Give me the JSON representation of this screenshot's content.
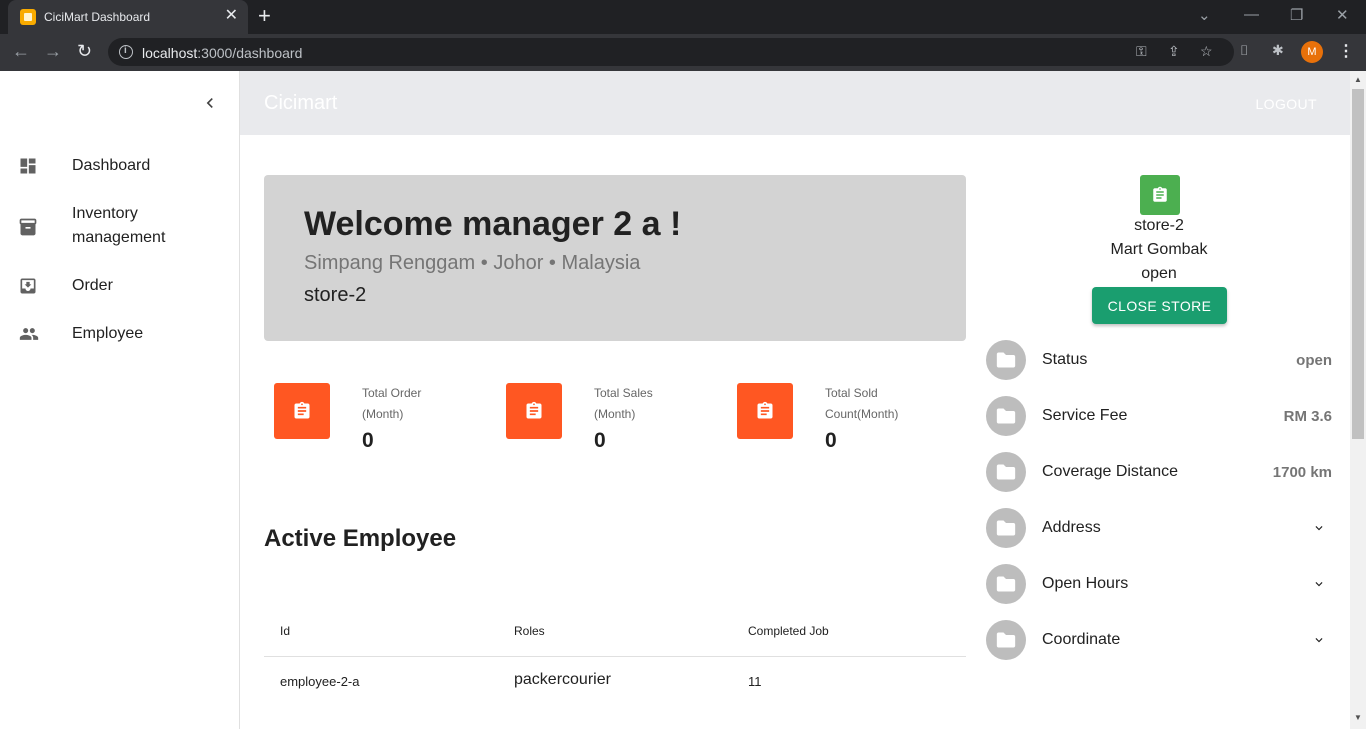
{
  "browser": {
    "tab_title": "CiciMart Dashboard",
    "url_host": "localhost",
    "url_path": ":3000/dashboard"
  },
  "appbar": {
    "brand": "Cicimart",
    "logout": "LOGOUT"
  },
  "sidebar": {
    "items": [
      {
        "label": "Dashboard",
        "icon": "dashboard-icon"
      },
      {
        "label": "Inventory management",
        "icon": "archive-icon"
      },
      {
        "label": "Order",
        "icon": "inbox-icon"
      },
      {
        "label": "Employee",
        "icon": "people-icon"
      }
    ]
  },
  "welcome": {
    "title": "Welcome manager 2 a !",
    "location": "Simpang Renggam • Johor • Malaysia",
    "store": "store-2"
  },
  "stats": [
    {
      "label": "Total Order (Month)",
      "value": "0"
    },
    {
      "label": "Total Sales (Month)",
      "value": "0"
    },
    {
      "label": "Total Sold Count(Month)",
      "value": "0"
    }
  ],
  "active_employee": {
    "title": "Active Employee",
    "columns": [
      "Id",
      "Roles",
      "Completed Job"
    ],
    "rows": [
      {
        "id": "employee-2-a",
        "roles": "packercourier",
        "completed_job": "11"
      }
    ]
  },
  "store_panel": {
    "store_id": "store-2",
    "name": "Mart Gombak",
    "status": "open",
    "close_button": "CLOSE STORE",
    "info": [
      {
        "label": "Status",
        "value": "open"
      },
      {
        "label": "Service Fee",
        "value": "RM 3.6"
      },
      {
        "label": "Coverage Distance",
        "value": "1700 km"
      },
      {
        "label": "Address",
        "value": ""
      },
      {
        "label": "Open Hours",
        "value": ""
      },
      {
        "label": "Coordinate",
        "value": ""
      }
    ]
  },
  "colors": {
    "accent_orange": "#ff5722",
    "store_green": "#4caf50",
    "close_button": "#1a9e6f",
    "welcome_bg": "#d3d3d3"
  }
}
